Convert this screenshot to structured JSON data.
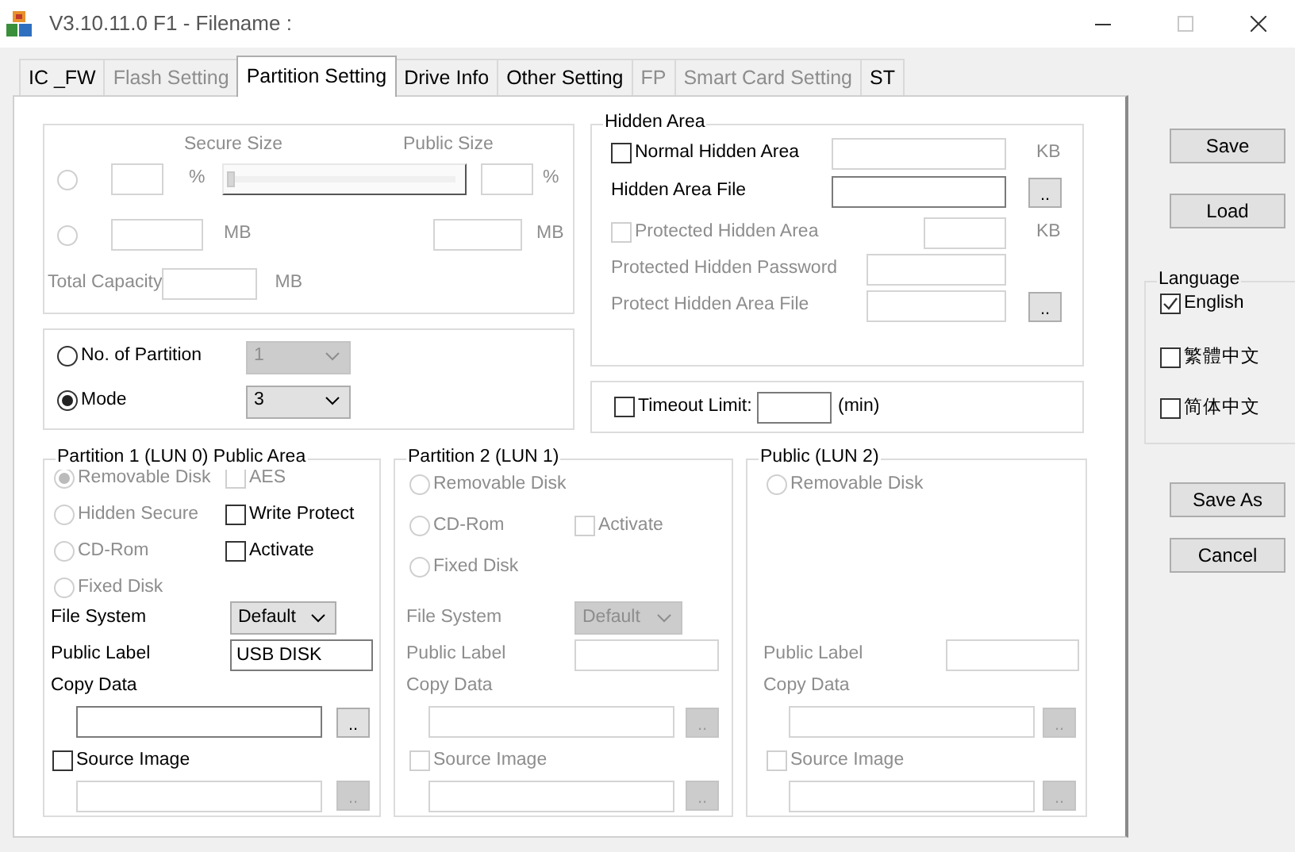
{
  "window": {
    "title": "V3.10.11.0 F1 - Filename :"
  },
  "tabs": [
    {
      "label": "IC _FW",
      "selected": false,
      "disabled": false
    },
    {
      "label": "Flash Setting",
      "selected": false,
      "disabled": true
    },
    {
      "label": "Partition Setting",
      "selected": true,
      "disabled": false
    },
    {
      "label": "Drive Info",
      "selected": false,
      "disabled": false
    },
    {
      "label": "Other Setting",
      "selected": false,
      "disabled": false
    },
    {
      "label": "FP",
      "selected": false,
      "disabled": true
    },
    {
      "label": "Smart Card Setting",
      "selected": false,
      "disabled": true
    },
    {
      "label": "ST",
      "selected": false,
      "disabled": false
    }
  ],
  "size_group": {
    "disabled": true,
    "secure_label": "Secure Size",
    "public_label": "Public Size",
    "percent_row": {
      "selected": false,
      "unit": "%",
      "public_unit": "%"
    },
    "slider": {
      "level": 0
    },
    "mb_row": {
      "selected": false,
      "unit": "MB",
      "public_unit": "MB"
    },
    "total_capacity": {
      "label": "Total Capacity",
      "unit": "MB"
    }
  },
  "partition_mode": {
    "options": [
      {
        "label": "No. of Partition",
        "selected": false,
        "value": "1",
        "value_disabled": true
      },
      {
        "label": "Mode",
        "selected": true,
        "value": "3",
        "value_disabled": false
      }
    ]
  },
  "hidden_area": {
    "title": "Hidden Area",
    "rows": [
      {
        "kind": "checkbox",
        "label": "Normal Hidden Area",
        "checked": false,
        "disabled": false,
        "field_disabled": true,
        "unit": "KB"
      },
      {
        "kind": "file",
        "label": "Hidden Area File",
        "disabled": false,
        "field_disabled": false,
        "browse": ".."
      },
      {
        "kind": "checkbox",
        "label": "Protected Hidden Area",
        "checked": false,
        "disabled": true,
        "field_disabled": true,
        "unit": "KB"
      },
      {
        "kind": "text",
        "label": "Protected Hidden Password",
        "disabled": true,
        "field_disabled": true
      },
      {
        "kind": "file",
        "label": "Protect Hidden Area File",
        "disabled": true,
        "field_disabled": true,
        "browse": ".."
      }
    ]
  },
  "timeout": {
    "label": "Timeout Limit:",
    "checked": false,
    "unit": "(min)"
  },
  "partitions": [
    {
      "title": "Partition 1 (LUN 0) Public Area",
      "rows": [
        {
          "disk": {
            "label": "Removable Disk",
            "selected": true,
            "disabled": true
          },
          "option": {
            "label": "AES",
            "checked": false,
            "disabled": true
          }
        },
        {
          "disk": {
            "label": "Hidden Secure",
            "selected": false,
            "disabled": true
          },
          "option": {
            "label": "Write Protect",
            "checked": false,
            "disabled": false
          }
        },
        {
          "disk": {
            "label": "CD-Rom",
            "selected": false,
            "disabled": true
          },
          "option": {
            "label": "Activate",
            "checked": false,
            "disabled": false
          }
        },
        {
          "disk": {
            "label": "Fixed Disk",
            "selected": false,
            "disabled": true
          }
        }
      ],
      "file_system": {
        "label": "File System",
        "value": "Default",
        "disabled": false
      },
      "public_label": {
        "label": "Public Label",
        "value": "USB DISK",
        "disabled": false
      },
      "copy_data": {
        "label": "Copy Data",
        "disabled": false,
        "browse": ".."
      },
      "source_image": {
        "label": "Source Image",
        "checked": false,
        "disabled": false,
        "field_disabled": true,
        "browse": ".."
      }
    },
    {
      "title": "Partition 2 (LUN 1)",
      "rows": [
        {
          "disk": {
            "label": "Removable Disk",
            "selected": false,
            "disabled": true
          }
        },
        {
          "disk": {
            "label": "CD-Rom",
            "selected": false,
            "disabled": true
          },
          "option": {
            "label": "Activate",
            "checked": false,
            "disabled": true
          }
        },
        {
          "disk": {
            "label": "Fixed Disk",
            "selected": false,
            "disabled": true
          }
        }
      ],
      "file_system": {
        "label": "File System",
        "value": "Default",
        "disabled": true
      },
      "public_label": {
        "label": "Public Label",
        "disabled": true
      },
      "copy_data": {
        "label": "Copy Data",
        "disabled": true,
        "browse": ".."
      },
      "source_image": {
        "label": "Source Image",
        "checked": false,
        "disabled": true,
        "field_disabled": true,
        "browse": ".."
      }
    },
    {
      "title": "Public (LUN 2)",
      "rows": [
        {
          "disk": {
            "label": "Removable Disk",
            "selected": false,
            "disabled": true
          }
        }
      ],
      "public_label": {
        "label": "Public Label",
        "disabled": true
      },
      "copy_data": {
        "label": "Copy Data",
        "disabled": true,
        "browse": ".."
      },
      "source_image": {
        "label": "Source Image",
        "checked": false,
        "disabled": true,
        "field_disabled": true,
        "browse": ".."
      }
    }
  ],
  "actions_top": [
    {
      "label": "Save"
    },
    {
      "label": "Load"
    }
  ],
  "language": {
    "title": "Language",
    "options": [
      {
        "label": "English",
        "checked": true
      },
      {
        "label": "繁體中文",
        "checked": false
      },
      {
        "label": "简体中文",
        "checked": false
      }
    ]
  },
  "actions_bottom": [
    {
      "label": "Save As"
    },
    {
      "label": "Cancel"
    }
  ]
}
